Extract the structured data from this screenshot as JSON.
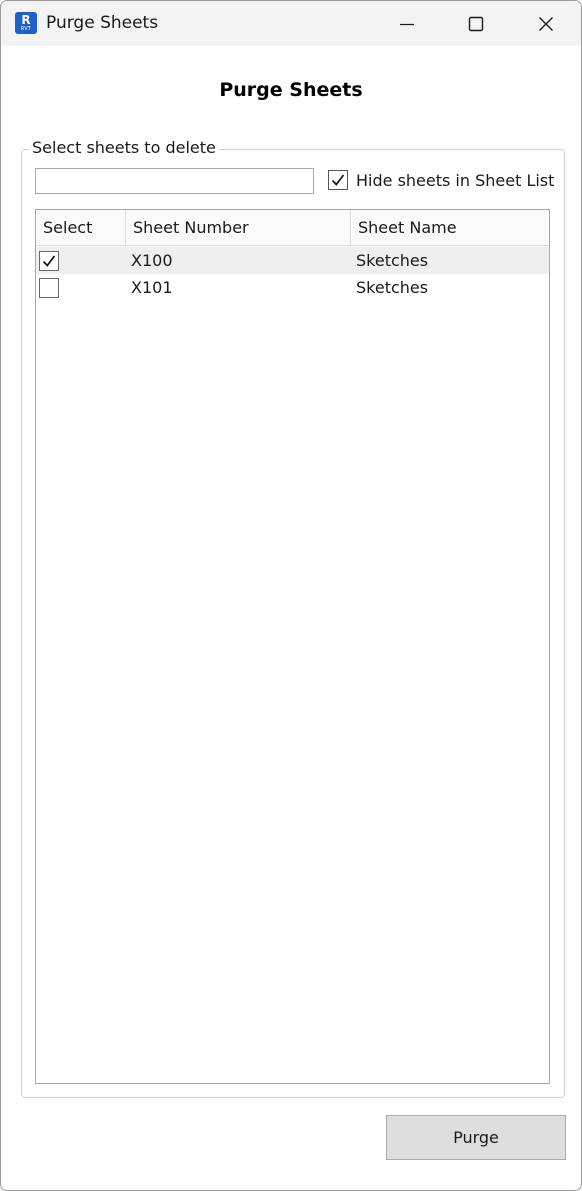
{
  "window": {
    "title": "Purge Sheets",
    "app_icon": {
      "letter": "R",
      "caption": "RVT",
      "color": "#1f5fc8"
    },
    "controls": [
      "minimize-icon",
      "maximize-icon",
      "close-icon"
    ]
  },
  "heading": "Purge Sheets",
  "group": {
    "legend": "Select sheets to delete",
    "filter": {
      "value": "",
      "placeholder": ""
    },
    "hide_checkbox": {
      "label": "Hide sheets in Sheet List",
      "checked": true
    }
  },
  "grid": {
    "columns": [
      "Select",
      "Sheet Number",
      "Sheet Name"
    ],
    "rows": [
      {
        "selected": true,
        "checked": true,
        "number": "X100",
        "name": "Sketches"
      },
      {
        "selected": false,
        "checked": false,
        "number": "X101",
        "name": "Sketches"
      }
    ]
  },
  "purge_button": "Purge"
}
